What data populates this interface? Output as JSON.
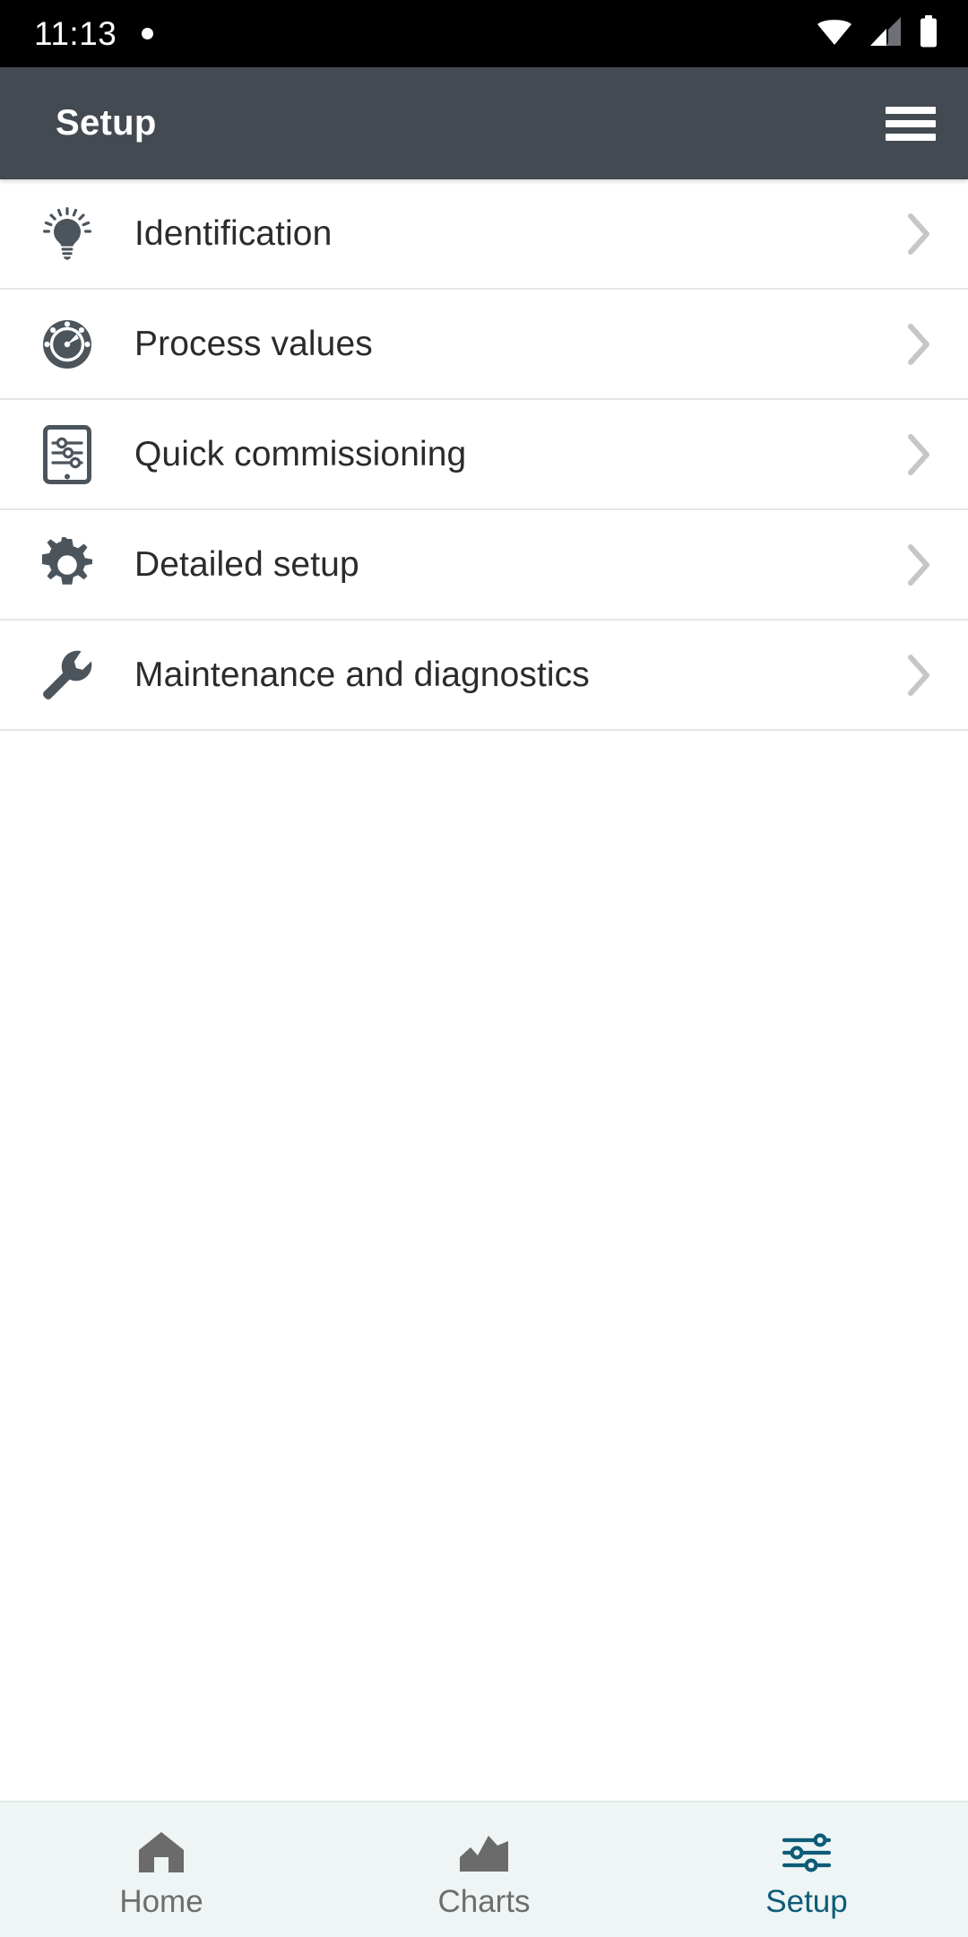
{
  "status_bar": {
    "time": "11:13",
    "notification_dot": "•",
    "icons": [
      "wifi-icon",
      "cellular-signal-icon",
      "battery-icon"
    ]
  },
  "app_bar": {
    "title": "Setup",
    "menu_icon": "hamburger-menu-icon"
  },
  "colors": {
    "app_bar_bg": "#434a52",
    "status_bar_bg": "#000000",
    "icon_dark": "#4c545c",
    "list_text": "#2b2b2b",
    "divider": "#e6e6e6",
    "chevron": "#c6c6c6",
    "bottom_nav_bg": "#eff4f4",
    "nav_active": "#0d5c78",
    "nav_inactive": "#6e6e6e"
  },
  "list": {
    "items": [
      {
        "label": "Identification",
        "icon": "lightbulb-icon",
        "chevron": "chevron-right-icon"
      },
      {
        "label": "Process values",
        "icon": "gauge-dial-icon",
        "chevron": "chevron-right-icon"
      },
      {
        "label": "Quick commissioning",
        "icon": "tablet-sliders-icon",
        "chevron": "chevron-right-icon"
      },
      {
        "label": "Detailed setup",
        "icon": "gear-icon",
        "chevron": "chevron-right-icon"
      },
      {
        "label": "Maintenance and diagnostics",
        "icon": "wrench-icon",
        "chevron": "chevron-right-icon"
      }
    ]
  },
  "bottom_nav": {
    "items": [
      {
        "label": "Home",
        "icon": "home-icon",
        "active": false
      },
      {
        "label": "Charts",
        "icon": "area-chart-icon",
        "active": false
      },
      {
        "label": "Setup",
        "icon": "sliders-icon",
        "active": true
      }
    ]
  }
}
